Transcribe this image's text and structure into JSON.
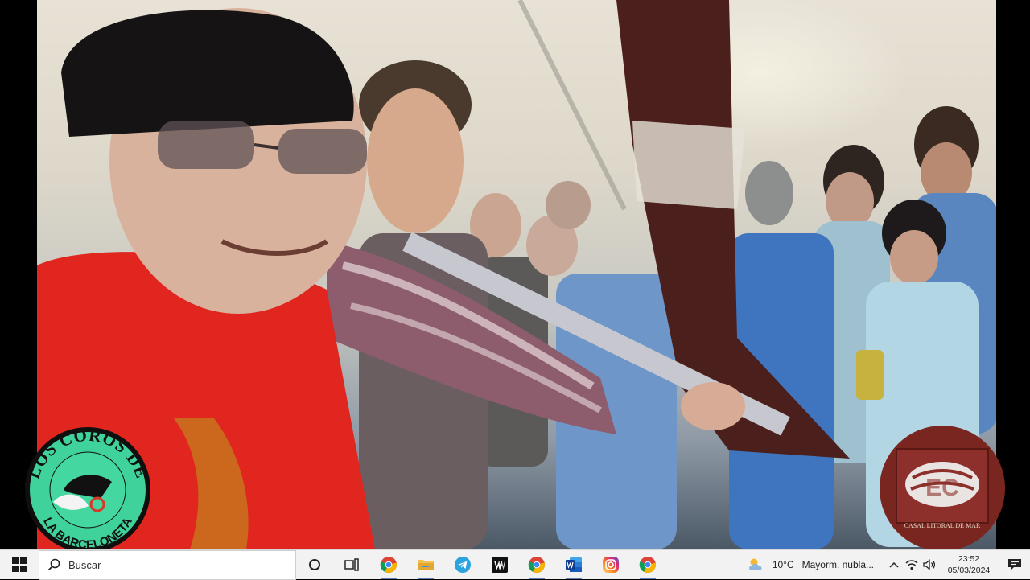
{
  "video": {
    "logo_left": {
      "line_top": "LOS COROS DE",
      "line_bottom": "LA BARCELONETA"
    },
    "logo_right": {
      "caption": "CASAL LITORAL DE MAR"
    }
  },
  "taskbar": {
    "search": {
      "placeholder": "Buscar"
    },
    "apps": [
      {
        "name": "task-view-icon"
      },
      {
        "name": "chrome-icon"
      },
      {
        "name": "file-explorer-icon"
      },
      {
        "name": "telegram-icon"
      },
      {
        "name": "wwe-app-icon"
      },
      {
        "name": "chrome-icon"
      },
      {
        "name": "word-icon"
      },
      {
        "name": "instagram-icon"
      },
      {
        "name": "chrome-icon"
      }
    ],
    "weather": {
      "temperature": "10°C",
      "description": "Mayorm. nubla..."
    },
    "clock": {
      "time": "23:52",
      "date": "05/03/2024"
    },
    "colors": {
      "accent": "#5a7fb3",
      "taskbar_bg": "#f2f2f2"
    }
  }
}
